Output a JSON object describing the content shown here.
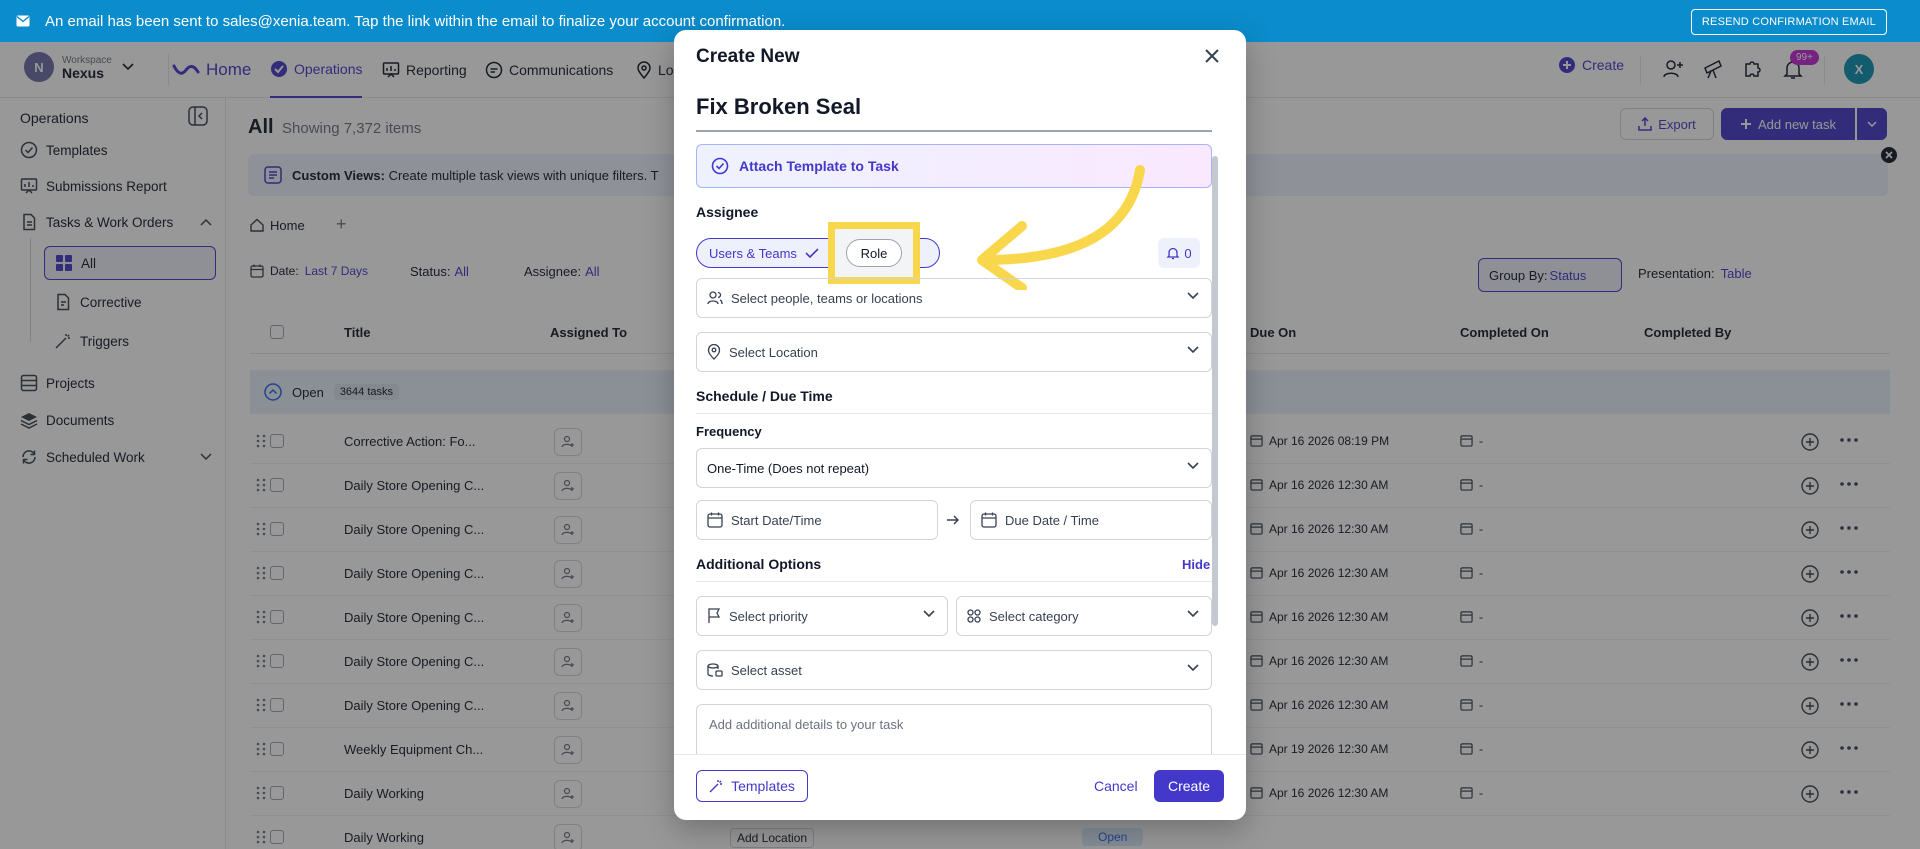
{
  "banner": {
    "message": "An email has been sent to sales@xenia.team. Tap the link within the email to finalize your account confirmation.",
    "resend_label": "RESEND CONFIRMATION EMAIL"
  },
  "workspace": {
    "initial": "N",
    "label": "Workspace",
    "name": "Nexus"
  },
  "nav": {
    "home": "Home",
    "operations": "Operations",
    "reporting": "Reporting",
    "communications": "Communications",
    "locations_partial": "Lo",
    "create": "Create",
    "notif_badge": "99+",
    "user_initial": "X"
  },
  "sidebar": {
    "title": "Operations",
    "templates": "Templates",
    "submissions": "Submissions Report",
    "tasks": "Tasks & Work Orders",
    "all": "All",
    "corrective": "Corrective",
    "triggers": "Triggers",
    "projects": "Projects",
    "documents": "Documents",
    "scheduled": "Scheduled Work"
  },
  "main": {
    "title": "All",
    "count": "Showing 7,372 items",
    "export": "Export",
    "add_new": "Add new task",
    "custom_views_bold": "Custom Views:",
    "custom_views_text": "Create multiple task views with unique filters. T",
    "tab_home": "Home",
    "filter_date_label": "Date:",
    "filter_date_value": "Last 7 Days",
    "filter_status_label": "Status:",
    "filter_status_value": "All",
    "filter_assignee_label": "Assignee:",
    "filter_assignee_value": "All",
    "group_by_label": "Group By:",
    "group_by_value": "Status",
    "presentation_label": "Presentation:",
    "presentation_value": "Table",
    "columns": {
      "title": "Title",
      "assigned": "Assigned To",
      "due": "Due On",
      "completed_on": "Completed On",
      "completed_by": "Completed By"
    },
    "group_open": "Open",
    "group_open_count": "3644 tasks",
    "rows": [
      {
        "title": "Corrective Action: Fo...",
        "due": "Apr 16 2026 08:19 PM",
        "completed": "-"
      },
      {
        "title": "Daily Store Opening C...",
        "due": "Apr 16 2026 12:30 AM",
        "completed": "-"
      },
      {
        "title": "Daily Store Opening C...",
        "due": "Apr 16 2026 12:30 AM",
        "completed": "-"
      },
      {
        "title": "Daily Store Opening C...",
        "due": "Apr 16 2026 12:30 AM",
        "completed": "-"
      },
      {
        "title": "Daily Store Opening C...",
        "due": "Apr 16 2026 12:30 AM",
        "completed": "-"
      },
      {
        "title": "Daily Store Opening C...",
        "due": "Apr 16 2026 12:30 AM",
        "completed": "-"
      },
      {
        "title": "Daily Store Opening C...",
        "due": "Apr 16 2026 12:30 AM",
        "completed": "-"
      },
      {
        "title": "Weekly Equipment Ch...",
        "due": "Apr 19 2026 12:30 AM",
        "completed": "-"
      },
      {
        "title": "Daily Working",
        "due": "Apr 16 2026 12:30 AM",
        "completed": "-"
      },
      {
        "title": "Daily Working",
        "due": "",
        "completed": ""
      }
    ],
    "add_location": "Add Location",
    "open_status": "Open"
  },
  "modal": {
    "header": "Create New",
    "task_title": "Fix Broken Seal",
    "attach_template": "Attach Template to Task",
    "assignee_label": "Assignee",
    "tab_users_teams": "Users & Teams",
    "tab_role": "Role",
    "notify_count": "0",
    "select_people_placeholder": "Select people, teams or locations",
    "select_location_placeholder": "Select Location",
    "schedule_label": "Schedule / Due Time",
    "frequency_label": "Frequency",
    "frequency_value": "One-Time (Does not repeat)",
    "start_placeholder": "Start Date/Time",
    "due_placeholder": "Due Date / Time",
    "additional_label": "Additional Options",
    "hide_label": "Hide",
    "priority_placeholder": "Select priority",
    "category_placeholder": "Select category",
    "asset_placeholder": "Select asset",
    "details_placeholder": "Add additional details to your task",
    "templates_button": "Templates",
    "cancel_button": "Cancel",
    "create_button": "Create"
  },
  "colors": {
    "accent": "#4338ca",
    "banner": "#0b8ccc",
    "highlight": "#f9d74c"
  }
}
